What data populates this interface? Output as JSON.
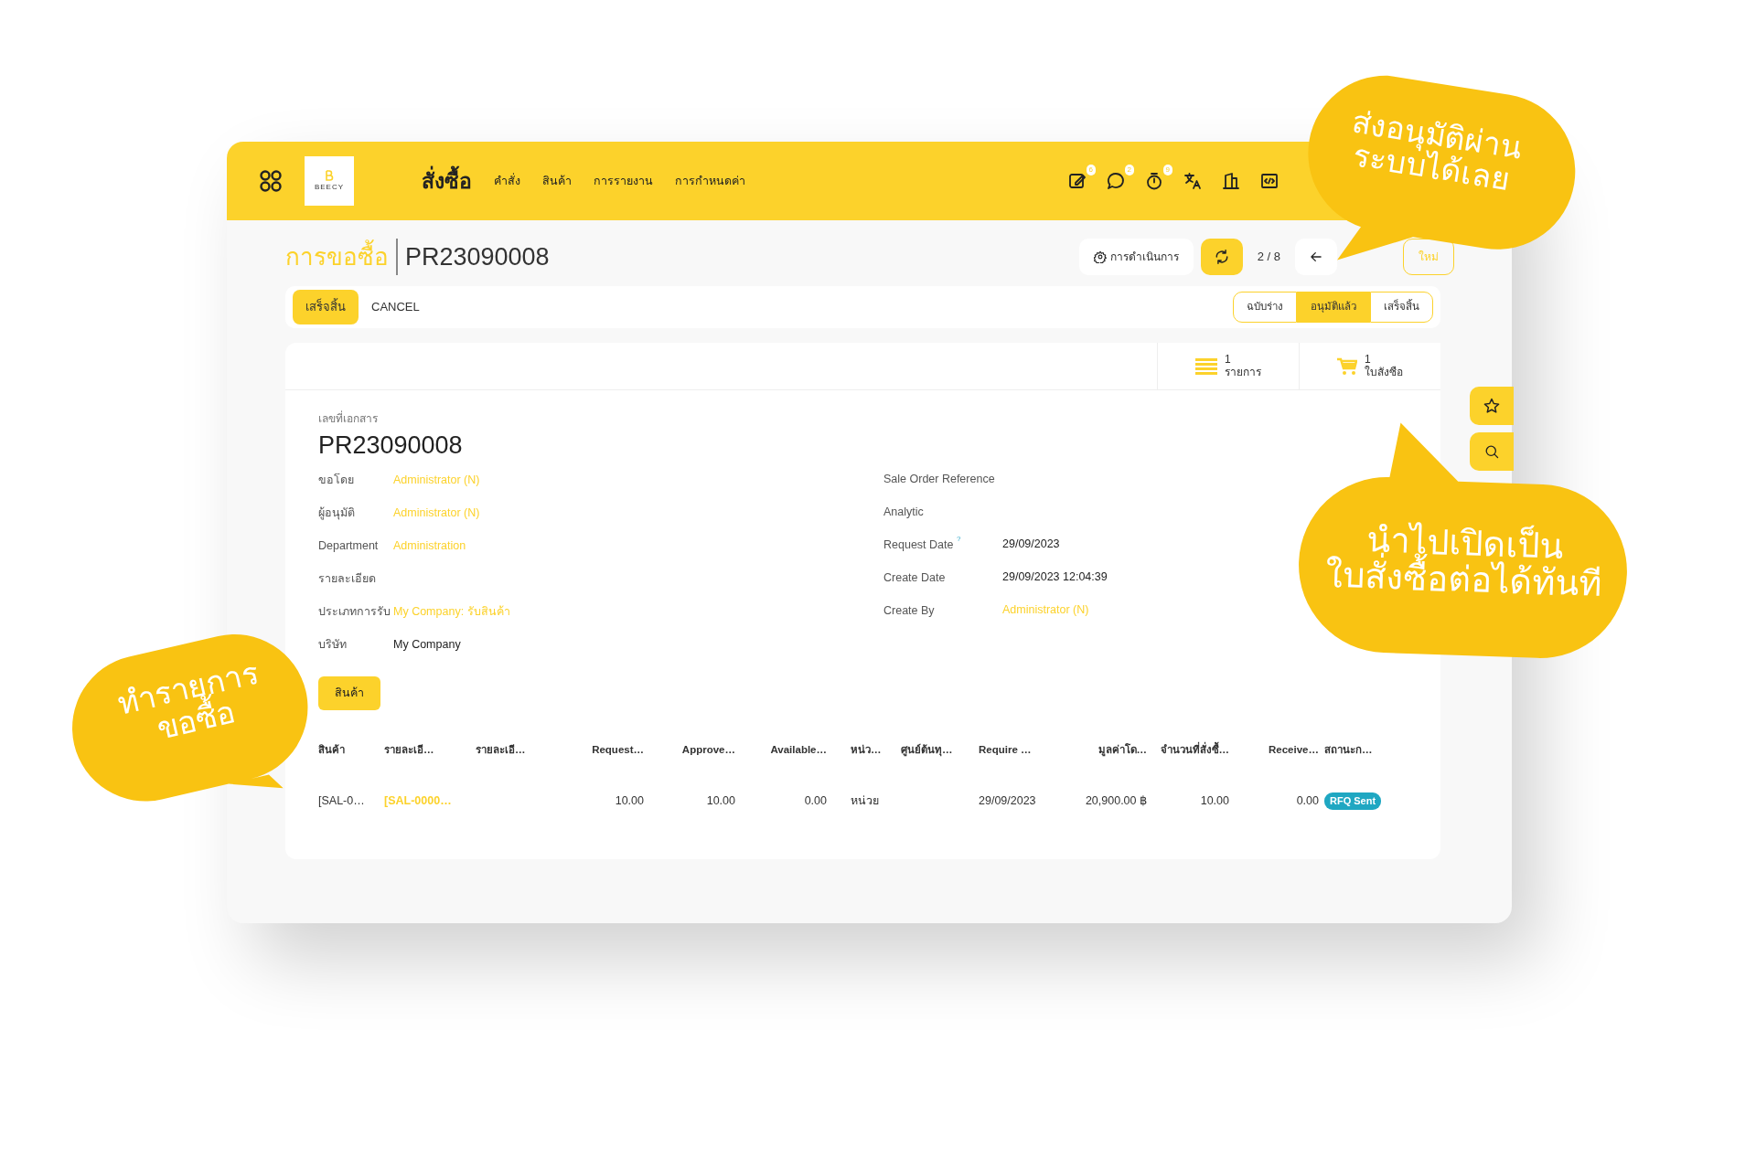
{
  "navbar": {
    "logo_text": "BEECY",
    "app_title": "สั่งซื้อ",
    "menu": [
      "คำสั่ง",
      "สินค้า",
      "การรายงาน",
      "การกำหนดค่า"
    ],
    "icons": [
      {
        "kind": "activity",
        "count": "6"
      },
      {
        "kind": "chat",
        "count": "2"
      },
      {
        "kind": "timer",
        "count": "9"
      },
      {
        "kind": "translate"
      },
      {
        "kind": "company"
      },
      {
        "kind": "code"
      }
    ]
  },
  "breadcrumb": {
    "parent": "การขอซื้อ",
    "current": "PR23090008"
  },
  "controls": {
    "action": "การดำเนินการ",
    "pager": "2 / 8",
    "new": "ใหม่"
  },
  "statusbar": {
    "buttons": [
      {
        "label": "เสร็จสิ้น",
        "kind": "primary"
      },
      {
        "label": "CANCEL",
        "kind": "secondary"
      }
    ],
    "stages": [
      {
        "label": "ฉบับร่าง",
        "selected": false
      },
      {
        "label": "อนุมัติแล้ว",
        "selected": true
      },
      {
        "label": "เสร็จสิ้น",
        "selected": false
      }
    ]
  },
  "smart_buttons": [
    {
      "kind": "list",
      "value": "1",
      "label": "รายการ"
    },
    {
      "kind": "cart",
      "value": "1",
      "label": "ใบสังซือ"
    }
  ],
  "form": {
    "doc_label": "เลขที่เอกสาร",
    "doc_number": "PR23090008",
    "left_fields": [
      {
        "label": "ขอโดย",
        "value": "Administrator (N)",
        "link": true
      },
      {
        "label": "ผู้อนุมัติ",
        "value": "Administrator (N)",
        "link": true
      },
      {
        "label": "Department",
        "value": "Administration",
        "link": true
      },
      {
        "label": "รายละเอียด"
      },
      {
        "label": "ประเภทการรับ",
        "value": "My Company: รับสินค้า",
        "link": true
      },
      {
        "label": "บริษัท",
        "value": "My Company",
        "link": false
      }
    ],
    "right_fields": [
      {
        "label": "Sale Order Reference"
      },
      {
        "label": "Analytic"
      },
      {
        "label": "Request Date",
        "help": "?",
        "value": "29/09/2023",
        "link": false
      },
      {
        "label": "Create Date",
        "value": "29/09/2023 12:04:39",
        "link": false
      },
      {
        "label": "Create By",
        "value": "Administrator (N)",
        "link": true
      }
    ]
  },
  "tabs": [
    {
      "label": "สินค้า",
      "selected": true
    }
  ],
  "table": {
    "columns": [
      {
        "label": "สินค้า",
        "numeric": false
      },
      {
        "label": "รายละเอี…",
        "numeric": false
      },
      {
        "label": "รายละเอี…",
        "numeric": false
      },
      {
        "label": "Request…",
        "numeric": true
      },
      {
        "label": "Approve…",
        "numeric": true
      },
      {
        "label": "Available…",
        "numeric": true
      },
      {
        "label": "หน่ว…",
        "numeric": false
      },
      {
        "label": "ศูนย์ต้นทุ…",
        "numeric": false
      },
      {
        "label": "Require …",
        "numeric": false
      },
      {
        "label": "มูลค่าโด…",
        "numeric": true
      },
      {
        "label": "จำนวนที่สั่งซื้…",
        "numeric": true
      },
      {
        "label": "Receive…",
        "numeric": true
      },
      {
        "label": "สถานะก…",
        "numeric": false
      }
    ],
    "rows": [
      {
        "cells": [
          {
            "kind": "text",
            "text": "[SAL-0…"
          },
          {
            "kind": "link",
            "text": "[SAL-0000…"
          },
          null,
          {
            "kind": "text",
            "text": "10.00"
          },
          {
            "kind": "text",
            "text": "10.00"
          },
          {
            "kind": "text",
            "text": "0.00"
          },
          {
            "kind": "text",
            "text": "หน่วย"
          },
          null,
          {
            "kind": "text",
            "text": "29/09/2023"
          },
          {
            "kind": "text",
            "text": "20,900.00 ฿"
          },
          {
            "kind": "text",
            "text": "10.00"
          },
          {
            "kind": "text",
            "text": "0.00"
          },
          {
            "kind": "badge",
            "text": "RFQ Sent"
          }
        ]
      }
    ]
  },
  "side_buttons": [
    {
      "kind": "star"
    },
    {
      "kind": "search"
    }
  ],
  "callouts": [
    {
      "lines": [
        "ส่งอนุมัติผ่าน",
        "ระบบได้เลย"
      ]
    },
    {
      "lines": [
        "นำไปเปิดเป็น",
        "ใบสั่งซื้อต่อได้ทันที"
      ]
    },
    {
      "lines": [
        "ทำรายการ",
        "ขอซื้อ"
      ]
    }
  ]
}
